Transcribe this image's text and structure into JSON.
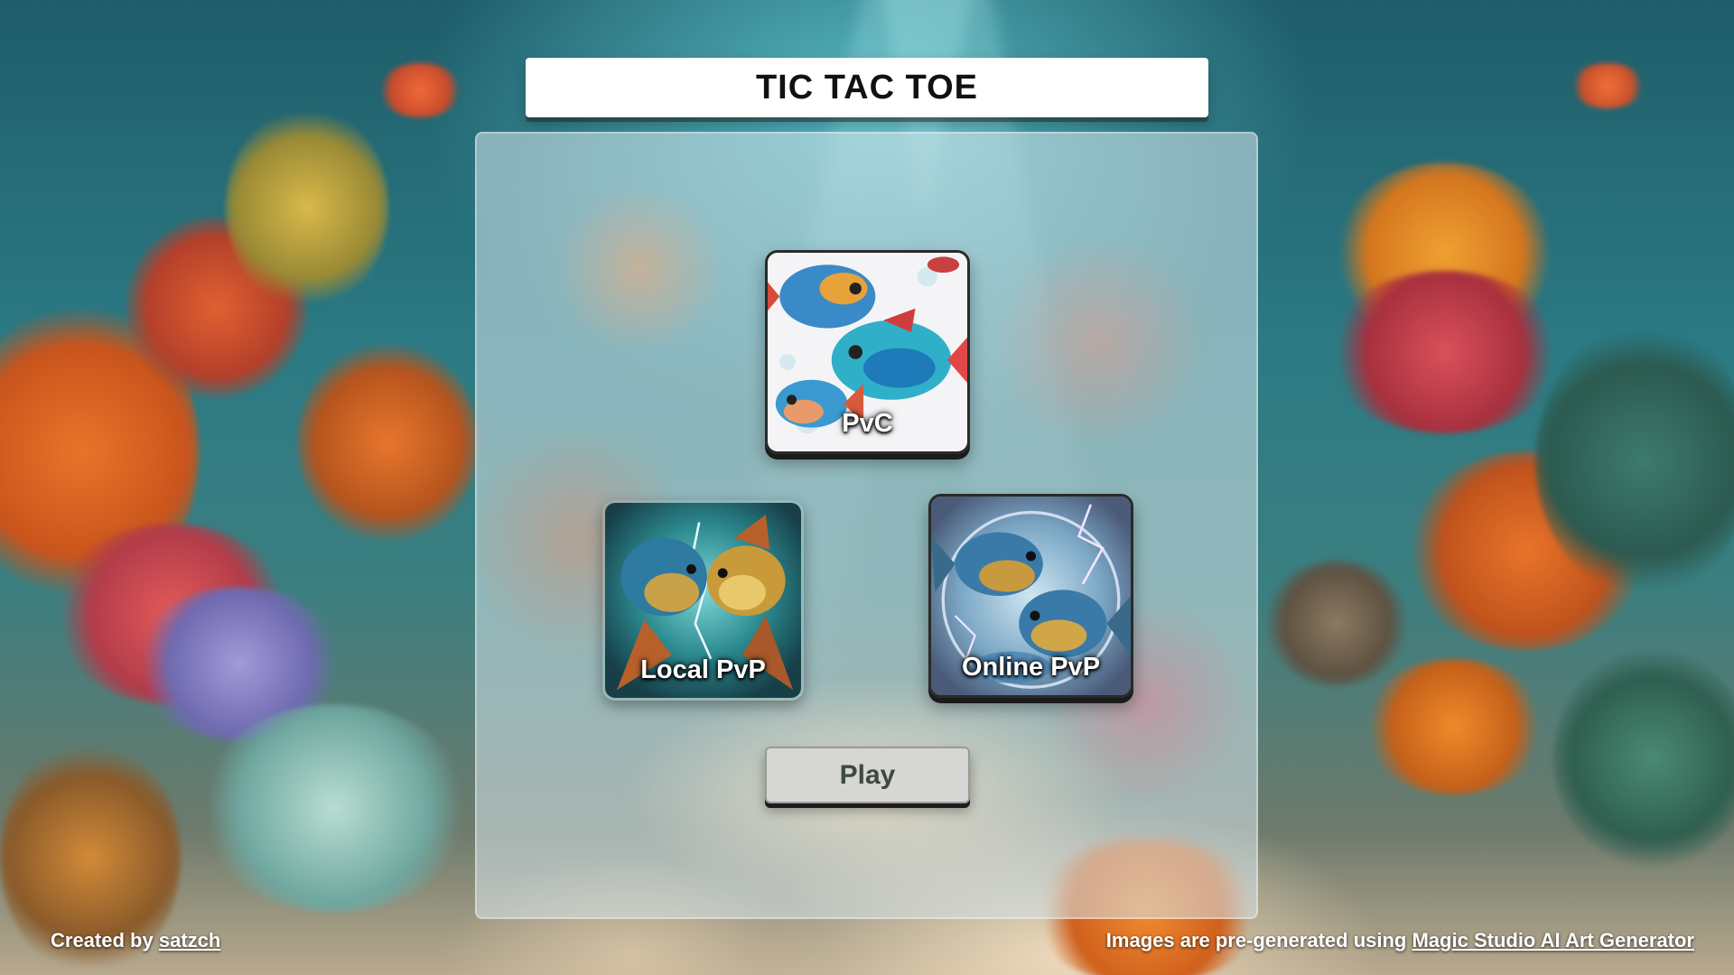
{
  "header": {
    "title": "TIC TAC TOE"
  },
  "modes": [
    {
      "label": "PvC",
      "icon": "fish-school-icon"
    },
    {
      "label": "Local PvP",
      "icon": "fish-duel-icon"
    },
    {
      "label": "Online PvP",
      "icon": "fish-duel-globe-icon"
    }
  ],
  "play_button": {
    "label": "Play"
  },
  "footer": {
    "credit_prefix": "Created by",
    "credit_author": "satzch",
    "images_prefix": "Images are pre-generated using",
    "images_link": "Magic Studio AI Art Generator"
  },
  "colors": {
    "title_background": "#ffffff",
    "play_button_background": "#d6d6d4",
    "play_button_text": "#3e4a40",
    "coral_orange": "#e8742a",
    "water_teal": "#2b7a84"
  }
}
